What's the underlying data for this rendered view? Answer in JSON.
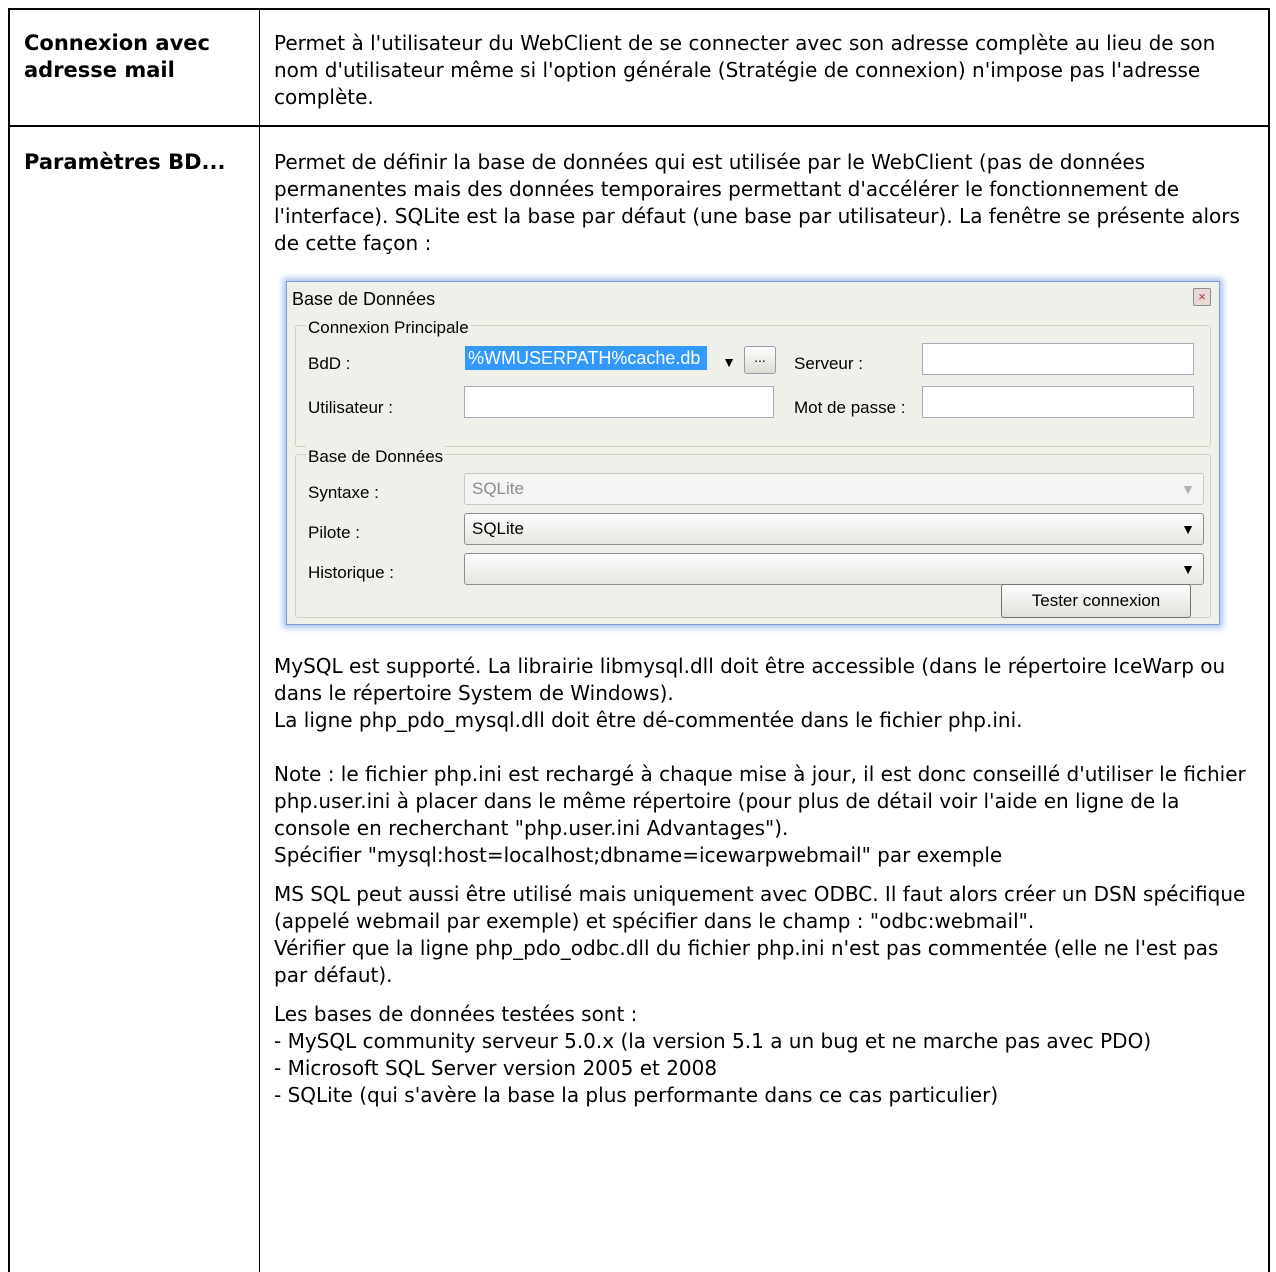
{
  "rows": [
    {
      "label": "Connexion avec adresse mail",
      "text": "Permet à l'utilisateur du WebClient de se connecter avec son adresse complète au lieu de son nom d'utilisateur même si l'option générale (Stratégie de connexion) n'impose pas l'adresse complète."
    },
    {
      "label": "Paramètres BD...",
      "intro": "Permet de définir la base de données qui est utilisée par le WebClient (pas de données permanentes mais des données temporaires permettant d'accélérer le fonctionnement de l'interface). SQLite est la base par défaut (une base par utilisateur). La fenêtre se présente alors de cette façon :",
      "paragraphs": [
        "MySQL est supporté. La librairie libmysql.dll doit être accessible (dans le répertoire IceWarp ou dans le répertoire System de Windows).\nLa ligne php_pdo_mysql.dll doit être dé-commentée dans le fichier php.ini.",
        "Note : le fichier php.ini est rechargé à chaque mise à jour, il est donc conseillé d'utiliser le fichier php.user.ini à placer dans le même répertoire (pour plus de détail voir l'aide en ligne de la console en recherchant \"php.user.ini Advantages\").\nSpécifier \"mysql:host=localhost;dbname=icewarpwebmail\" par exemple",
        "MS SQL peut aussi être utilisé mais uniquement avec ODBC. Il faut alors créer un DSN spécifique (appelé webmail par exemple) et spécifier dans le champ : \"odbc:webmail\".\nVérifier que la ligne php_pdo_odbc.dll du fichier php.ini n'est pas commentée (elle ne l'est pas par défaut).",
        "Les bases de données testées sont :\n- MySQL community serveur 5.0.x (la version 5.1 a un bug et ne marche pas avec PDO)\n- Microsoft SQL Server version 2005 et 2008\n- SQLite (qui s'avère la base la plus performante dans ce cas particulier)"
      ]
    }
  ],
  "dialog": {
    "title": "Base de Données",
    "close_icon": "close-icon",
    "group1": {
      "title": "Connexion Principale",
      "bdd_label": "BdD :",
      "bdd_value": "%WMUSERPATH%cache.db",
      "browse_label": "...",
      "serveur_label": "Serveur :",
      "serveur_value": "",
      "utilisateur_label": "Utilisateur :",
      "utilisateur_value": "",
      "motdepasse_label": "Mot de passe :",
      "motdepasse_value": ""
    },
    "group2": {
      "title": "Base de Données",
      "syntaxe_label": "Syntaxe :",
      "syntaxe_value": "SQLite",
      "pilote_label": "Pilote :",
      "pilote_value": "SQLite",
      "historique_label": "Historique :",
      "historique_value": ""
    },
    "test_button": "Tester connexion",
    "accent_color": "#3399ff"
  }
}
